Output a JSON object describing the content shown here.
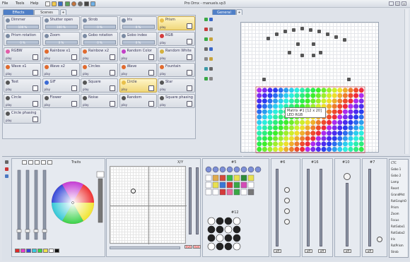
{
  "menu": {
    "file": "File",
    "tools": "Tools",
    "help": "Help"
  },
  "window_title": "Pro Dmx - manuels.vp3",
  "tabs": {
    "effects": "Effects",
    "scenes": "Scenes",
    "general": "General"
  },
  "effects": [
    {
      "name": "Dimmer",
      "value": "100 %",
      "type": "slider",
      "color": "#7a8aa2"
    },
    {
      "name": "Shutter open",
      "value": "100 %",
      "type": "slider",
      "color": "#7a8aa2"
    },
    {
      "name": "Strob",
      "value": "0 %",
      "type": "slider",
      "color": "#7a8aa2"
    },
    {
      "name": "Iris",
      "value": "0 %",
      "type": "slider",
      "color": "#7a8aa2"
    },
    {
      "name": "Prism",
      "value": "",
      "type": "button",
      "color": "#e9c04b",
      "highlight": true
    },
    {
      "name": "Prism rotation",
      "value": "0 %",
      "type": "slider",
      "color": "#7a8aa2"
    },
    {
      "name": "Zoom",
      "value": "0 %",
      "type": "slider",
      "color": "#7a8aa2"
    },
    {
      "name": "Gobo rotation",
      "value": "0 %",
      "type": "slider",
      "color": "#7a8aa2"
    },
    {
      "name": "Gobo index",
      "value": "0 %",
      "type": "slider",
      "color": "#7a8aa2"
    },
    {
      "name": "RGB",
      "value": "",
      "type": "button",
      "color": "#d43a3a"
    },
    {
      "name": "RGBW",
      "value": "",
      "type": "button",
      "color": "#e25ca8"
    },
    {
      "name": "Rainbow x1",
      "value": "",
      "type": "button",
      "color": "#e06a2e"
    },
    {
      "name": "Rainbow x2",
      "value": "",
      "type": "button",
      "color": "#e06a2e"
    },
    {
      "name": "Random Color",
      "value": "",
      "type": "button",
      "color": "#c23fc6"
    },
    {
      "name": "Random White",
      "value": "",
      "type": "button",
      "color": "#d4b13e"
    },
    {
      "name": "Wave x1",
      "value": "",
      "type": "button",
      "color": "#e06a2e"
    },
    {
      "name": "Wave x2",
      "value": "",
      "type": "button",
      "color": "#e06a2e"
    },
    {
      "name": "Circles",
      "value": "",
      "type": "button",
      "color": "#e06a2e"
    },
    {
      "name": "Wave",
      "value": "",
      "type": "button",
      "color": "#e06a2e"
    },
    {
      "name": "Fountain",
      "value": "",
      "type": "button",
      "color": "#e06a2e"
    },
    {
      "name": "Text",
      "value": "",
      "type": "button",
      "color": "#555"
    },
    {
      "name": "GIF",
      "value": "",
      "type": "button",
      "color": "#3a6ad4"
    },
    {
      "name": "Square",
      "value": "",
      "type": "button",
      "color": "#555"
    },
    {
      "name": "Circle",
      "value": "",
      "type": "button",
      "color": "#e9c04b",
      "highlight": true
    },
    {
      "name": "Star",
      "value": "",
      "type": "button",
      "color": "#555"
    },
    {
      "name": "Circle",
      "value": "",
      "type": "button",
      "color": "#555"
    },
    {
      "name": "Flower",
      "value": "",
      "type": "button",
      "color": "#555"
    },
    {
      "name": "Noise",
      "value": "",
      "type": "button",
      "color": "#555"
    },
    {
      "name": "Random",
      "value": "",
      "type": "button",
      "color": "#555"
    },
    {
      "name": "Square phasing",
      "value": "",
      "type": "button",
      "color": "#555"
    },
    {
      "name": "Circle phasing",
      "value": "",
      "type": "button",
      "color": "#555"
    }
  ],
  "mini_label": "play",
  "matrix_tooltip": {
    "line1": "Matrix #1 [12 x 20]",
    "line2": "LED RGB"
  },
  "bottom": {
    "traits_label": "Traits",
    "xy_label": "X/Y",
    "p5_label": "#5",
    "p12_label": "#12",
    "p6_label": "#6",
    "p16_label": "#16",
    "p8_label": "#8",
    "p10_label": "#10",
    "p7_label": "#7",
    "off_label": "off",
    "live_label": "live"
  },
  "ctc_list": [
    "CTC",
    "Gobo 1",
    "Gobo 2",
    "Lamp",
    "Reset",
    "GrandMst",
    "RotGraphO",
    "Prism",
    "Zoom",
    "Focus",
    "RotGobo1",
    "RotGobo2",
    "Iris",
    "RotPrism",
    "Strob"
  ],
  "colors": {
    "accent": "#4a78c2",
    "highlight": "#f0d77a",
    "panel": "#e6eaf0"
  }
}
